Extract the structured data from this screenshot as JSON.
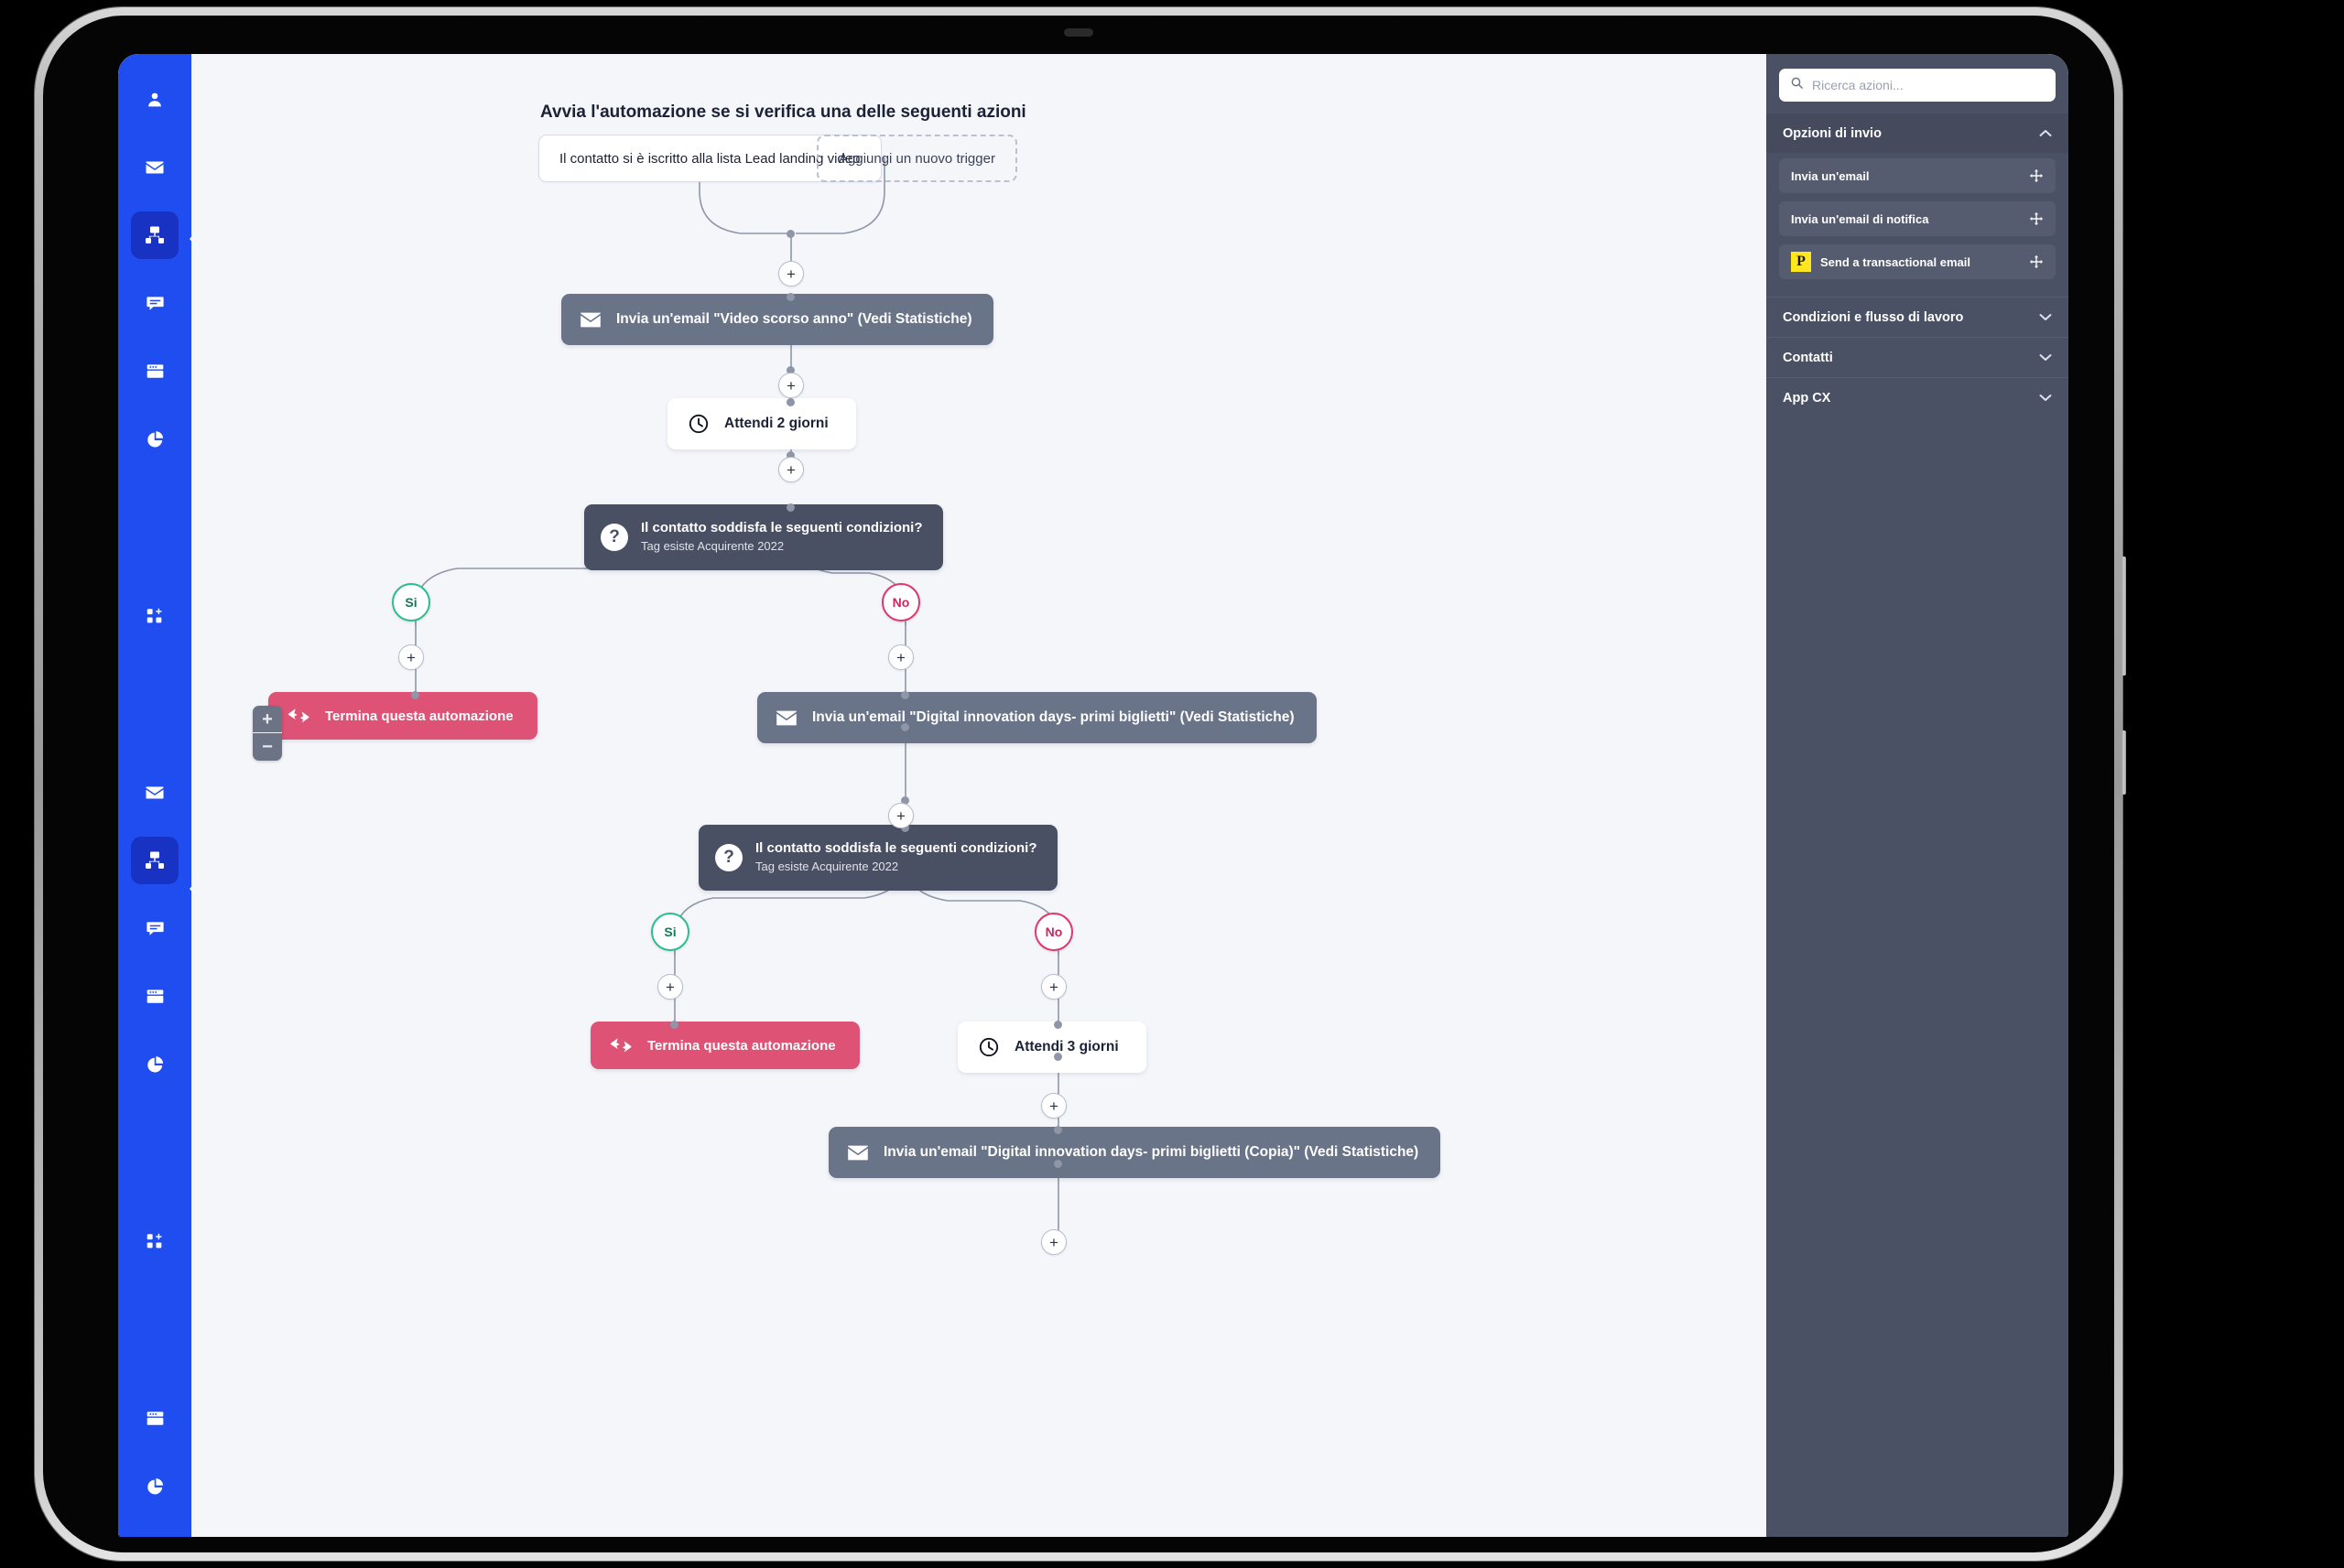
{
  "app": {
    "left_rail": {
      "groups": [
        {
          "items": [
            {
              "name": "contacts-icon",
              "icon": "user",
              "active": false
            },
            {
              "name": "email-icon",
              "icon": "envelope",
              "active": false
            },
            {
              "name": "automation-icon",
              "icon": "sitemap",
              "active": true
            },
            {
              "name": "chat-icon",
              "icon": "chat",
              "active": false
            },
            {
              "name": "landing-page-icon",
              "icon": "browser",
              "active": false
            },
            {
              "name": "statistics-icon",
              "icon": "pie-chart",
              "active": false
            }
          ]
        },
        {
          "items": [
            {
              "name": "apps-icon",
              "icon": "grid-plus",
              "active": false
            }
          ]
        },
        {
          "items": [
            {
              "name": "email-icon",
              "icon": "envelope",
              "active": false
            },
            {
              "name": "automation-icon",
              "icon": "sitemap",
              "active": true
            },
            {
              "name": "chat-icon",
              "icon": "chat",
              "active": false
            },
            {
              "name": "landing-page-icon",
              "icon": "browser",
              "active": false
            },
            {
              "name": "statistics-icon",
              "icon": "pie-chart",
              "active": false
            }
          ]
        },
        {
          "items": [
            {
              "name": "apps-icon",
              "icon": "grid-plus",
              "active": false
            }
          ]
        },
        {
          "items": [
            {
              "name": "landing-page-icon",
              "icon": "browser",
              "active": false
            },
            {
              "name": "statistics-icon",
              "icon": "pie-chart",
              "active": false
            }
          ]
        }
      ]
    },
    "canvas": {
      "title": "Avvia l'automazione se si verifica una delle seguenti azioni",
      "zoom_in_label": "+",
      "zoom_out_label": "−",
      "plus_label": "+",
      "triggers": [
        {
          "label": "Il contatto si è iscritto alla lista Lead landing video",
          "style": "solid"
        },
        {
          "label": "Aggiungi un nuovo trigger",
          "style": "dashed"
        }
      ],
      "nodes": {
        "email_1": "Invia un'email \"Video scorso anno\" (Vedi Statistiche)",
        "wait_1": "Attendi 2 giorni",
        "cond_1_title": "Il contatto soddisfa le seguenti condizioni?",
        "cond_1_sub": "Tag esiste Acquirente 2022",
        "branch_1_yes": "Si",
        "branch_1_no": "No",
        "end_1": "Termina questa automazione",
        "email_2": "Invia un'email \"Digital innovation days- primi biglietti\" (Vedi Statistiche)",
        "cond_2_title": "Il contatto soddisfa le seguenti condizioni?",
        "cond_2_sub": "Tag esiste Acquirente 2022",
        "branch_2_yes": "Si",
        "branch_2_no": "No",
        "end_2": "Termina questa automazione",
        "wait_2": "Attendi 3 giorni",
        "email_3": "Invia un'email \"Digital innovation days- primi biglietti (Copia)\" (Vedi Statistiche)"
      }
    },
    "right_panel": {
      "search_placeholder": "Ricerca azioni...",
      "search_value": "",
      "sections": [
        {
          "label": "Opzioni di invio",
          "expanded": true,
          "items": [
            {
              "label": "Invia un'email",
              "badge": null
            },
            {
              "label": "Invia un'email di notifica",
              "badge": null
            },
            {
              "label": "Send a transactional email",
              "badge": "P"
            }
          ]
        },
        {
          "label": "Condizioni e flusso di lavoro",
          "expanded": false,
          "items": []
        },
        {
          "label": "Contatti",
          "expanded": false,
          "items": []
        },
        {
          "label": "App CX",
          "expanded": false,
          "items": []
        }
      ]
    },
    "colors": {
      "rail": "#1f4df0",
      "rail_active": "#1832c4",
      "panel": "#4b5164",
      "email_node": "#6a7489",
      "condition_node": "#4a5063",
      "end_node": "#dd5275",
      "yes": "#2bbd8e",
      "no": "#e0376b",
      "badge_yellow": "#ffe71f"
    }
  }
}
